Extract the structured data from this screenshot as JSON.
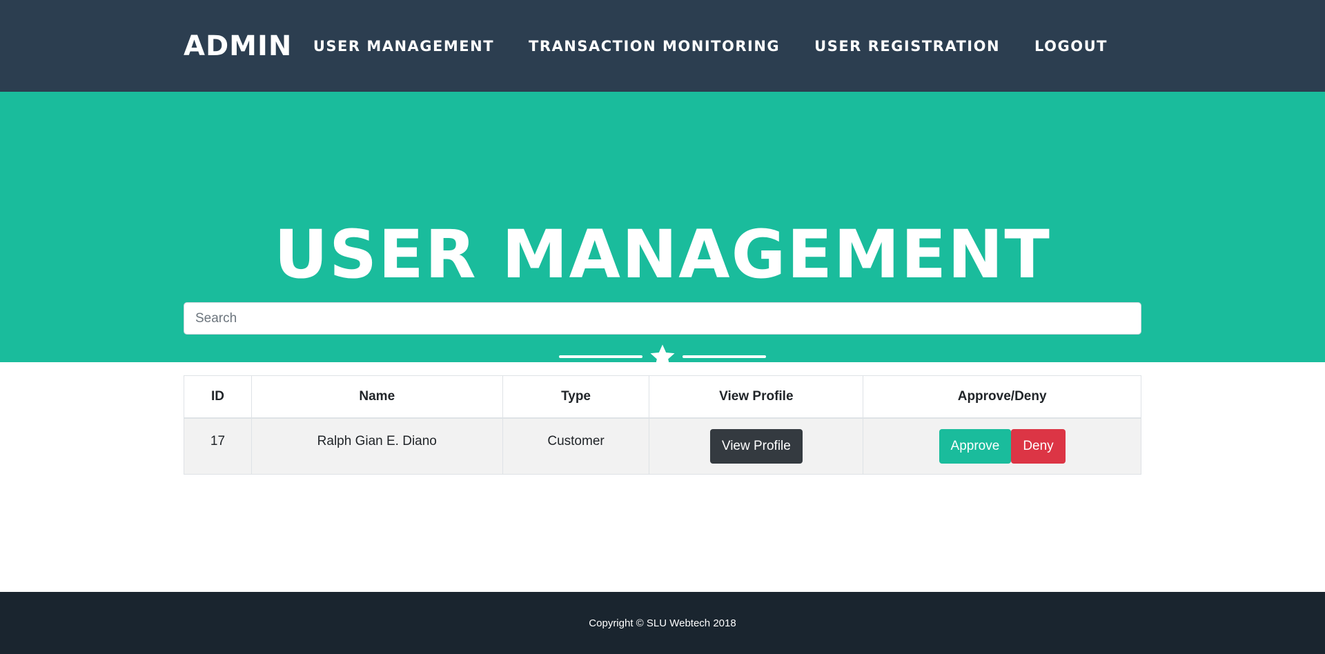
{
  "navbar": {
    "brand": "ADMIN",
    "links": [
      "USER MANAGEMENT",
      "TRANSACTION MONITORING",
      "USER REGISTRATION",
      "LOGOUT"
    ]
  },
  "masthead": {
    "title": "USER MANAGEMENT",
    "star_icon": "star-icon"
  },
  "search": {
    "placeholder": "Search",
    "value": ""
  },
  "table": {
    "headers": [
      "ID",
      "Name",
      "Type",
      "View Profile",
      "Approve/Deny"
    ],
    "rows": [
      {
        "id": "17",
        "name": "Ralph Gian E. Diano",
        "type": "Customer",
        "view_label": "View Profile",
        "approve_label": "Approve",
        "deny_label": "Deny"
      }
    ]
  },
  "footer": {
    "copyright": "Copyright © SLU Webtech 2018"
  },
  "colors": {
    "navbar": "#2c3e50",
    "primary": "#1abc9c",
    "danger": "#dc3545",
    "dark": "#343a40",
    "footer": "#1a252f"
  }
}
